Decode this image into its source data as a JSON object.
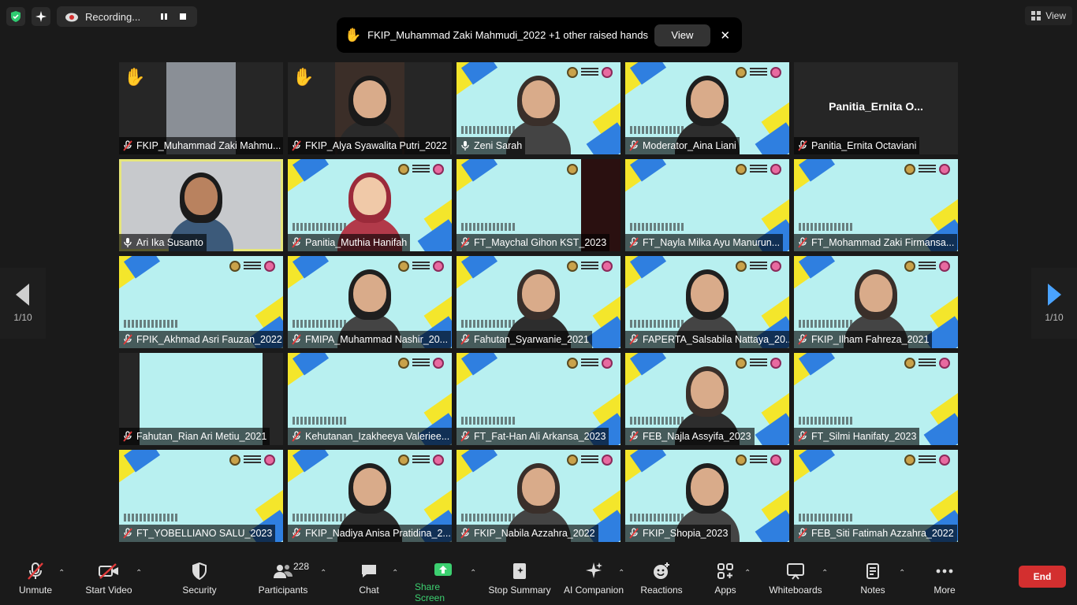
{
  "top": {
    "recording_label": "Recording...",
    "view_label": "View"
  },
  "notification": {
    "text": "FKIP_Muhammad Zaki Mahmudi_2022 +1 other raised hands",
    "view_label": "View",
    "close_glyph": "✕"
  },
  "pagination": {
    "left": "1/10",
    "right": "1/10"
  },
  "tiles": [
    {
      "name": "FKIP_Muhammad Zaki Mahmu...",
      "hand": "✋",
      "muted": true
    },
    {
      "name": "FKIP_Alya Syawalita Putri_2022",
      "hand": "✋",
      "muted": true
    },
    {
      "name": "Zeni Sarah",
      "muted": false
    },
    {
      "name": "Moderator_Aina Liani",
      "muted": true
    },
    {
      "name": "Panitia_Ernita Octaviani",
      "big_name": "Panitia_Ernita  O...",
      "muted": true
    },
    {
      "name": "Ari Ika Susanto",
      "muted": false
    },
    {
      "name": "Panitia_Muthia Hanifah",
      "muted": true
    },
    {
      "name": "FT_Maychal Gihon KST_2023",
      "muted": true
    },
    {
      "name": "FT_Nayla Milka Ayu Manurun...",
      "muted": true
    },
    {
      "name": "FT_Mohammad Zaki Firmansa...",
      "muted": true
    },
    {
      "name": "FPIK_Akhmad Asri Fauzan_2022",
      "muted": true
    },
    {
      "name": "FMIPA_Muhammad Nashir_20...",
      "muted": true
    },
    {
      "name": "Fahutan_Syarwanie_2021",
      "muted": true
    },
    {
      "name": "FAPERTA_Salsabila Nattaya_20...",
      "muted": true
    },
    {
      "name": "FKIP_Ilham Fahreza_2021",
      "muted": true
    },
    {
      "name": "Fahutan_Rian Ari Metiu_2021",
      "muted": true
    },
    {
      "name": "Kehutanan_Izakheeya Valeriee...",
      "muted": true
    },
    {
      "name": "FT_Fat-Han Ali Arkansa_2023",
      "muted": true
    },
    {
      "name": "FEB_Najla Assyifa_2023",
      "muted": true
    },
    {
      "name": "FT_Silmi Hanifaty_2023",
      "muted": true
    },
    {
      "name": "FT_YOBELLIANO SALU_2023",
      "muted": true
    },
    {
      "name": "FKIP_Nadiya Anisa Pratidina_2...",
      "muted": true
    },
    {
      "name": "FKIP_Nabila Azzahra_2022",
      "muted": true
    },
    {
      "name": "FKIP_Shopia_2023",
      "muted": true
    },
    {
      "name": "FEB_Siti Fatimah Azzahra_2022",
      "muted": true
    }
  ],
  "toolbar": {
    "unmute": "Unmute",
    "start_video": "Start Video",
    "security": "Security",
    "participants": "Participants",
    "participants_count": "228",
    "chat": "Chat",
    "share_screen": "Share Screen",
    "stop_summary": "Stop Summary",
    "ai_companion": "AI Companion",
    "reactions": "Reactions",
    "apps": "Apps",
    "whiteboards": "Whiteboards",
    "notes": "Notes",
    "more": "More",
    "end": "End"
  },
  "colors": {
    "tile_bg": "#b8f0f0",
    "stripe_yellow": "#f4e62b",
    "stripe_blue": "#2f7fe0",
    "active_speaker": "#e6e67a",
    "share_green": "#3cd070",
    "end_red": "#d32f2f",
    "shield_green": "#2ecc71"
  }
}
